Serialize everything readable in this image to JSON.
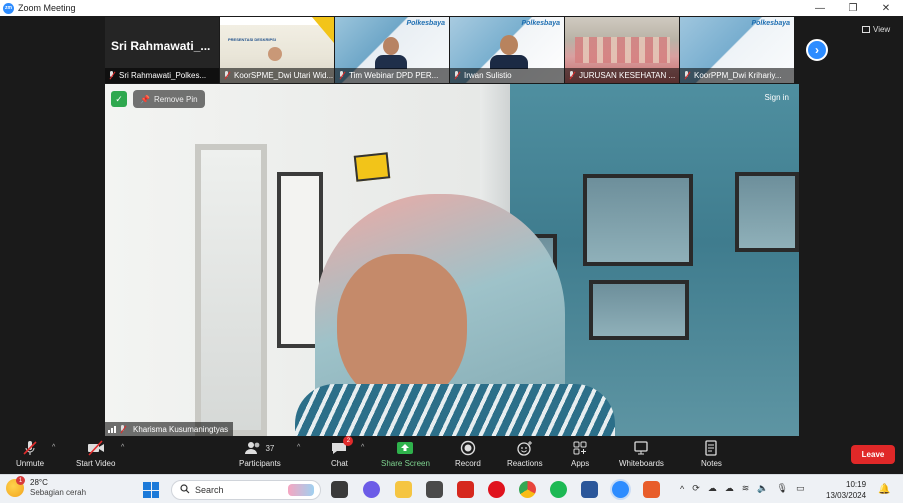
{
  "window": {
    "title": "Zoom Meeting",
    "controls": [
      "—",
      "❐",
      "✕"
    ]
  },
  "gallery": {
    "active_speaker_name": "Sri  Rahmawati_...",
    "tiles": [
      {
        "name": "Sri Rahmawati_Polkes...",
        "icon": "mic-muted-icon"
      },
      {
        "name": "KoorSPME_Dwi Utari Wid...",
        "icon": "mic-muted-icon"
      },
      {
        "name": "Tim Webinar DPD PER...",
        "icon": "mic-muted-icon"
      },
      {
        "name": "Irwan Sulistio",
        "icon": "mic-muted-icon"
      },
      {
        "name": "JURUSAN KESEHATAN ...",
        "icon": "mic-muted-icon"
      },
      {
        "name": "KoorPPM_Dwi Krihariy...",
        "icon": "mic-muted-icon"
      }
    ],
    "logo_text": "Polkesbaya",
    "slide_text": "PRESENTASI DESKRIPSI",
    "next_icon": "chevron-right-icon",
    "view_label": "View"
  },
  "main_video": {
    "remove_pin_label": "Remove Pin",
    "sign_in_label": "Sign in",
    "participant_name": "Kharisma Kusumaningtyas",
    "security_icon": "shield-check-icon"
  },
  "toolbar": {
    "unmute": "Unmute",
    "start_video": "Start Video",
    "participants": "Participants",
    "participants_count": "37",
    "chat": "Chat",
    "chat_badge": "2",
    "share_screen": "Share Screen",
    "record": "Record",
    "reactions": "Reactions",
    "apps": "Apps",
    "whiteboards": "Whiteboards",
    "notes": "Notes",
    "leave": "Leave",
    "share_color": "#2fb24c",
    "leave_color": "#e02828"
  },
  "taskbar": {
    "weather_temp": "28°C",
    "weather_condition": "Sebagian cerah",
    "weather_badge": "1",
    "search_placeholder": "Search",
    "time": "10:19",
    "date": "13/03/2024"
  }
}
